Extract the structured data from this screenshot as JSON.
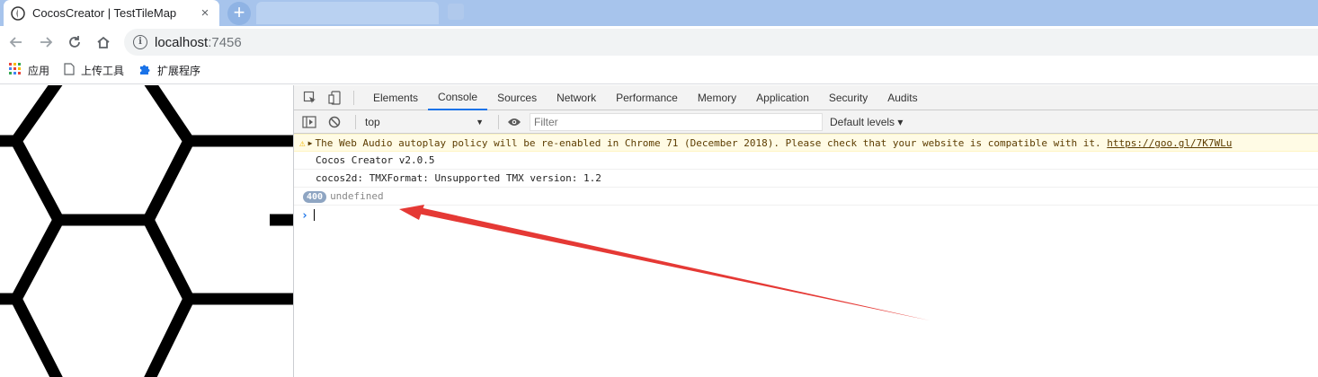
{
  "browser": {
    "tab_title": "CocosCreator | TestTileMap",
    "tab_close": "×",
    "new_tab": "+",
    "url_host": "localhost",
    "url_port": ":7456"
  },
  "bookmarks": [
    {
      "label": "应用"
    },
    {
      "label": "上传工具"
    },
    {
      "label": "扩展程序"
    }
  ],
  "devtools": {
    "tabs": [
      "Elements",
      "Console",
      "Sources",
      "Network",
      "Performance",
      "Memory",
      "Application",
      "Security",
      "Audits"
    ],
    "active_tab": "Console",
    "context": "top",
    "filter_placeholder": "Filter",
    "levels": "Default levels ▾"
  },
  "console": {
    "warning_text": "The Web Audio autoplay policy will be re-enabled in Chrome 71 (December 2018). Please check that your website is compatible with it.",
    "warning_link": "https://goo.gl/7K7WLu",
    "log1": "Cocos Creator v2.0.5",
    "log2": "cocos2d: TMXFormat: Unsupported TMX version: 1.2",
    "result_badge": "400",
    "result_value": "undefined",
    "prompt_symbol": "›"
  },
  "colors": {
    "tab_strip": "#a7c4ec",
    "active_tab_underline": "#1a73e8",
    "warning_bg": "#fffbe5",
    "annotation_arrow": "#e53935"
  }
}
